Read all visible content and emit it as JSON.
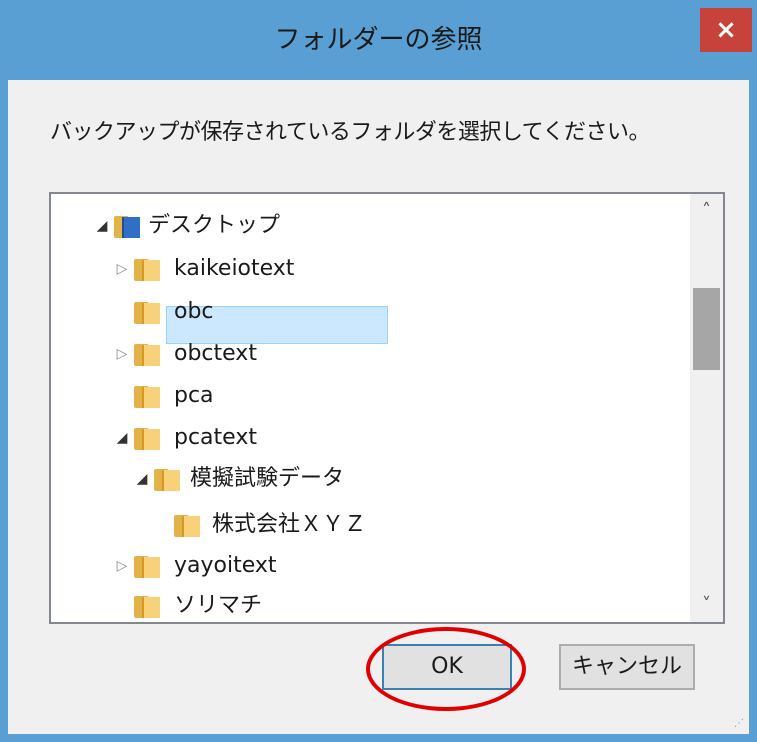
{
  "dialog": {
    "title": "フォルダーの参照",
    "close_label": "×",
    "prompt": "バックアップが保存されているフォルダを選択してください。"
  },
  "tree": {
    "items": [
      {
        "label": "デスクトップ",
        "expander": "◢",
        "icon": "desktop-icon",
        "expanded": true
      },
      {
        "label": "kaikeiotext",
        "expander": "▷",
        "icon": "folder-icon",
        "expanded": false
      },
      {
        "label": "obc",
        "expander": "",
        "icon": "folder-icon"
      },
      {
        "label": "obctext",
        "expander": "▷",
        "icon": "folder-icon",
        "expanded": false
      },
      {
        "label": "pca",
        "expander": "",
        "icon": "folder-icon"
      },
      {
        "label": "pcatext",
        "expander": "◢",
        "icon": "folder-icon",
        "expanded": true
      },
      {
        "label": "模擬試験データ",
        "expander": "◢",
        "icon": "folder-icon",
        "expanded": true
      },
      {
        "label": "株式会社ＸＹＺ",
        "expander": "",
        "icon": "folder-icon",
        "selected": true
      },
      {
        "label": "yayoitext",
        "expander": "▷",
        "icon": "folder-icon",
        "expanded": false
      },
      {
        "label": "ソリマチ",
        "expander": "",
        "icon": "folder-icon"
      }
    ]
  },
  "scrollbar": {
    "up_glyph": "˄",
    "down_glyph": "˅"
  },
  "buttons": {
    "ok_label": "OK",
    "cancel_label": "キャンセル"
  },
  "colors": {
    "titlebar": "#5a9fd4",
    "close": "#c7423a",
    "selection": "#cce8ff",
    "annotation": "#e00000"
  }
}
